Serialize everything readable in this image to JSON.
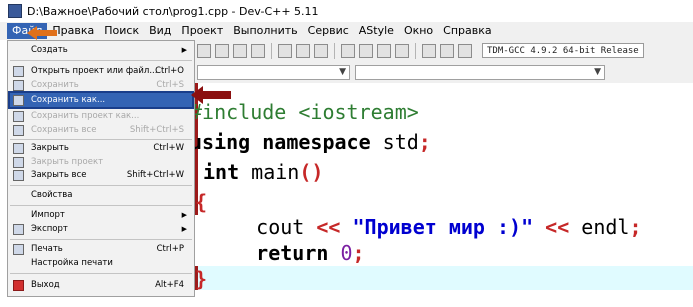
{
  "window": {
    "title": "D:\\Важное\\Рабочий стол\\prog1.cpp - Dev-C++ 5.11"
  },
  "menubar": {
    "items": [
      "Файл",
      "Правка",
      "Поиск",
      "Вид",
      "Проект",
      "Выполнить",
      "Сервис",
      "AStyle",
      "Окно",
      "Справка"
    ],
    "active_index": 0
  },
  "toolbar": {
    "compiler": "TDM-GCC 4.9.2 64-bit Release"
  },
  "file_menu": {
    "items": [
      {
        "label": "Создать",
        "shortcut": "",
        "submenu": true,
        "enabled": true,
        "icon": "none"
      },
      {
        "label": "Открыть проект или файл...",
        "shortcut": "Ctrl+O",
        "submenu": false,
        "enabled": true,
        "icon": "open-folder-icon"
      },
      {
        "label": "Сохранить",
        "shortcut": "Ctrl+S",
        "submenu": false,
        "enabled": false,
        "icon": "save-icon"
      },
      {
        "label": "Сохранить как...",
        "shortcut": "",
        "submenu": false,
        "enabled": true,
        "selected": true,
        "icon": "save-as-icon"
      },
      {
        "label": "Сохранить проект как...",
        "shortcut": "",
        "submenu": false,
        "enabled": false,
        "icon": "save-project-icon"
      },
      {
        "label": "Сохранить все",
        "shortcut": "Shift+Ctrl+S",
        "submenu": false,
        "enabled": false,
        "icon": "save-all-icon"
      },
      {
        "label": "Закрыть",
        "shortcut": "Ctrl+W",
        "submenu": false,
        "enabled": true,
        "icon": "close-file-icon"
      },
      {
        "label": "Закрыть проект",
        "shortcut": "",
        "submenu": false,
        "enabled": false,
        "icon": "close-project-icon"
      },
      {
        "label": "Закрыть все",
        "shortcut": "Shift+Ctrl+W",
        "submenu": false,
        "enabled": true,
        "icon": "close-all-icon"
      },
      {
        "label": "Свойства",
        "shortcut": "",
        "submenu": false,
        "enabled": true,
        "icon": "none"
      },
      {
        "label": "Импорт",
        "shortcut": "",
        "submenu": true,
        "enabled": true,
        "icon": "none"
      },
      {
        "label": "Экспорт",
        "shortcut": "",
        "submenu": true,
        "enabled": true,
        "icon": "export-icon"
      },
      {
        "label": "Печать",
        "shortcut": "Ctrl+P",
        "submenu": false,
        "enabled": true,
        "icon": "printer-icon"
      },
      {
        "label": "Настройка печати",
        "shortcut": "",
        "submenu": false,
        "enabled": true,
        "icon": "none"
      },
      {
        "label": "Выход",
        "shortcut": "Alt+F4",
        "submenu": false,
        "enabled": true,
        "icon": "exit-icon"
      }
    ]
  },
  "editor": {
    "lines": [
      {
        "parts": [
          {
            "t": "#include <iostream>",
            "c": "preproc"
          }
        ]
      },
      {
        "parts": [
          {
            "t": "using namespace",
            "c": "kw"
          },
          {
            "t": " std",
            "c": "id"
          },
          {
            "t": ";",
            "c": "op"
          }
        ]
      },
      {
        "parts": [
          {
            "t": "int",
            "c": "kw"
          },
          {
            "t": " main",
            "c": "id"
          },
          {
            "t": "()",
            "c": "op"
          }
        ]
      },
      {
        "parts": [
          {
            "t": "{",
            "c": "op"
          }
        ]
      },
      {
        "parts": [
          {
            "t": "    cout ",
            "c": "id"
          },
          {
            "t": "<<",
            "c": "op"
          },
          {
            "t": " \"Привет мир :)\" ",
            "c": "str"
          },
          {
            "t": "<<",
            "c": "op"
          },
          {
            "t": " endl",
            "c": "id"
          },
          {
            "t": ";",
            "c": "op"
          }
        ]
      },
      {
        "parts": [
          {
            "t": "    ",
            "c": "id"
          },
          {
            "t": "return",
            "c": "kw"
          },
          {
            "t": " ",
            "c": "id"
          },
          {
            "t": "0",
            "c": "num"
          },
          {
            "t": ";",
            "c": "op"
          }
        ]
      },
      {
        "parts": [
          {
            "t": "}",
            "c": "op"
          }
        ]
      }
    ]
  },
  "colors": {
    "menu_highlight": "#3464b4",
    "annotation_arrow_menu": "#e0701a",
    "annotation_arrow_save": "#8b1010",
    "current_line": "#e0fbff"
  }
}
